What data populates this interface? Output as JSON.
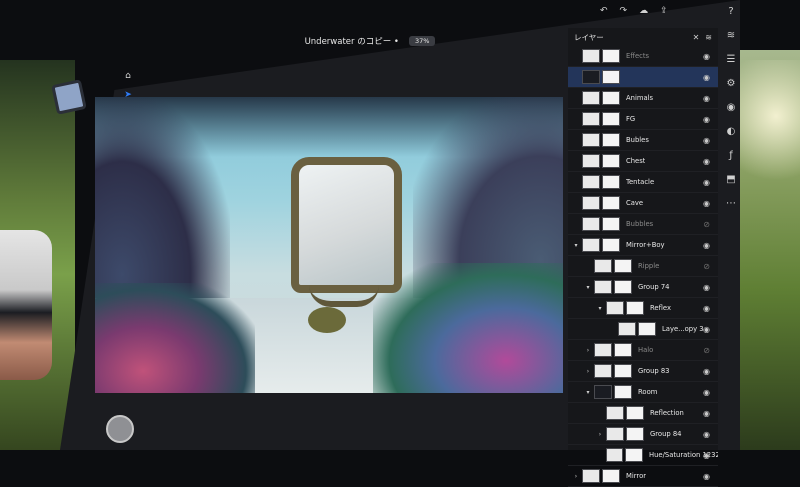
{
  "document": {
    "title": "Underwater のコピー •",
    "zoom": "37%"
  },
  "toolbar": {
    "icons": [
      "home-icon",
      "move-icon",
      "select-icon",
      "lasso-icon",
      "layers-icon",
      "more-icon",
      "brush-icon",
      "eraser-icon",
      "fill-icon",
      "stamp-icon",
      "heal-icon",
      "crop-icon",
      "text-icon",
      "image-icon",
      "eyedropper-icon"
    ],
    "active_index": 1,
    "color_swatch": "#1f5fd0"
  },
  "layers_panel": {
    "title": "レイヤー",
    "layers": [
      {
        "name": "Effects",
        "visible": true,
        "dim": true,
        "indent": 0,
        "expander": "",
        "thumb": "light",
        "selected": false
      },
      {
        "name": "",
        "visible": true,
        "dim": false,
        "indent": 0,
        "expander": "",
        "thumb": "dark",
        "selected": true
      },
      {
        "name": "Animals",
        "visible": true,
        "dim": false,
        "indent": 0,
        "expander": "",
        "thumb": "light",
        "selected": false
      },
      {
        "name": "FG",
        "visible": true,
        "dim": false,
        "indent": 0,
        "expander": "",
        "thumb": "light",
        "selected": false
      },
      {
        "name": "Bubles",
        "visible": true,
        "dim": false,
        "indent": 0,
        "expander": "",
        "thumb": "light",
        "selected": false
      },
      {
        "name": "Chest",
        "visible": true,
        "dim": false,
        "indent": 0,
        "expander": "",
        "thumb": "light",
        "selected": false
      },
      {
        "name": "Tentacle",
        "visible": true,
        "dim": false,
        "indent": 0,
        "expander": "",
        "thumb": "light",
        "selected": false
      },
      {
        "name": "Cave",
        "visible": true,
        "dim": false,
        "indent": 0,
        "expander": "",
        "thumb": "light",
        "selected": false
      },
      {
        "name": "Bubbles",
        "visible": false,
        "dim": true,
        "indent": 0,
        "expander": "",
        "thumb": "light",
        "selected": false
      },
      {
        "name": "Mirror+Boy",
        "visible": true,
        "dim": false,
        "indent": 0,
        "expander": "▾",
        "thumb": "light",
        "selected": false
      },
      {
        "name": "Ripple",
        "visible": false,
        "dim": true,
        "indent": 1,
        "expander": "",
        "thumb": "light",
        "selected": false
      },
      {
        "name": "Group 74",
        "visible": true,
        "dim": false,
        "indent": 1,
        "expander": "▾",
        "thumb": "light",
        "selected": false
      },
      {
        "name": "Reflex",
        "visible": true,
        "dim": false,
        "indent": 2,
        "expander": "▾",
        "thumb": "light",
        "selected": false
      },
      {
        "name": "Laye...opy 3",
        "visible": true,
        "dim": false,
        "indent": 3,
        "expander": "",
        "thumb": "light",
        "selected": false
      },
      {
        "name": "Halo",
        "visible": false,
        "dim": true,
        "indent": 1,
        "expander": "›",
        "thumb": "light",
        "selected": false
      },
      {
        "name": "Group 83",
        "visible": true,
        "dim": false,
        "indent": 1,
        "expander": "›",
        "thumb": "light",
        "selected": false
      },
      {
        "name": "Room",
        "visible": true,
        "dim": false,
        "indent": 1,
        "expander": "▾",
        "thumb": "dark",
        "selected": false
      },
      {
        "name": "Reflection",
        "visible": true,
        "dim": false,
        "indent": 2,
        "expander": "",
        "thumb": "light",
        "selected": false
      },
      {
        "name": "Group 84",
        "visible": true,
        "dim": false,
        "indent": 2,
        "expander": "›",
        "thumb": "light",
        "selected": false
      },
      {
        "name": "Hue/Saturation 1232",
        "visible": true,
        "dim": false,
        "indent": 2,
        "expander": "",
        "thumb": "light",
        "selected": false
      },
      {
        "name": "Mirror",
        "visible": true,
        "dim": false,
        "indent": 0,
        "expander": "›",
        "thumb": "light",
        "selected": false
      }
    ]
  },
  "rail_icons": [
    "help-icon",
    "layers-stack-icon",
    "adjustments-icon",
    "settings-icon",
    "eye-icon",
    "mask-icon",
    "fx-icon",
    "fill-icon",
    "more-icon"
  ],
  "top_icons": [
    "undo-icon",
    "redo-icon",
    "cloud-icon",
    "share-icon"
  ]
}
